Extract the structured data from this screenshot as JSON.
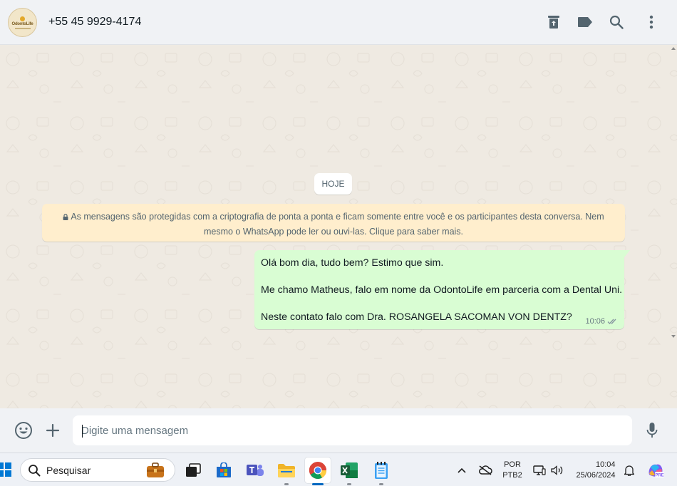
{
  "header": {
    "contact_name": "+55 45 9929-4174",
    "avatar_brand": "OdontoLife",
    "icons": [
      "archive-icon",
      "label-icon",
      "search-icon",
      "more-options-icon"
    ]
  },
  "chat": {
    "date_label": "HOJE",
    "encryption_notice": "As mensagens são protegidas com a criptografia de ponta a ponta e ficam somente entre você e os participantes desta conversa. Nem mesmo o WhatsApp pode ler ou ouvi-las. Clique para saber mais.",
    "messages": [
      {
        "direction": "outgoing",
        "lines": [
          "Olá bom dia, tudo bem? Estimo que sim.",
          "Me chamo Matheus, falo em nome da OdontoLife em parceria com a Dental Uni.",
          "Neste contato falo com Dra. ROSANGELA SACOMAN VON DENTZ?"
        ],
        "time": "10:06",
        "status": "delivered"
      }
    ]
  },
  "composer": {
    "placeholder": "Digite uma mensagem",
    "value": ""
  },
  "taskbar": {
    "search_label": "Pesquisar",
    "language_line1": "POR",
    "language_line2": "PTB2",
    "time": "10:04",
    "date": "25/06/2024",
    "copilot_badge": "PRE"
  },
  "colors": {
    "chat_background": "#efeae2",
    "outgoing_bubble": "#d9fdd3",
    "encryption_bg": "#ffeecd",
    "header_bg": "#f0f2f5",
    "icon_gray": "#54656f"
  }
}
